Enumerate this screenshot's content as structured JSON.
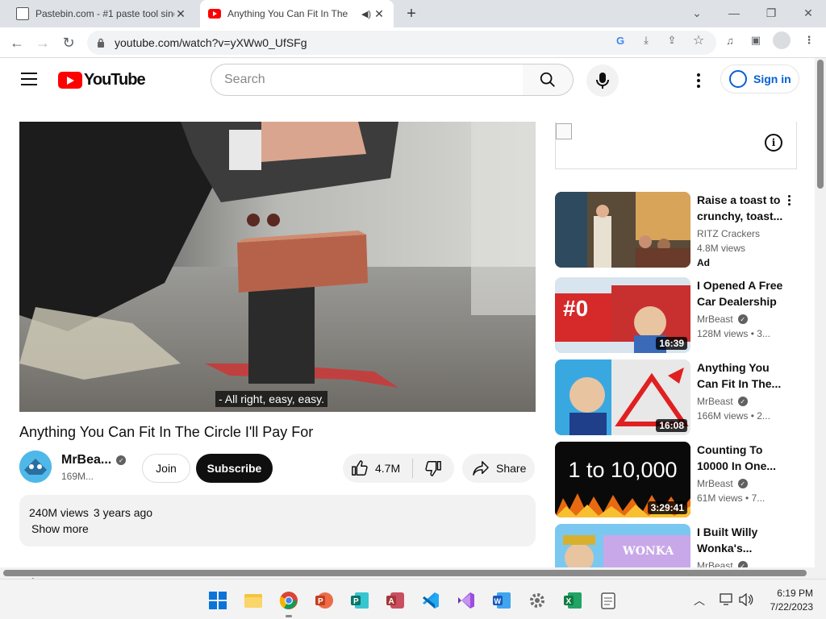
{
  "browser": {
    "tabs": [
      {
        "title": "Pastebin.com - #1 paste tool sinc",
        "active": false
      },
      {
        "title": "Anything You Can Fit In The",
        "active": true
      }
    ],
    "url": "youtube.com/watch?v=yXWw0_UfSFg"
  },
  "youtube": {
    "logo_text": "YouTube",
    "search_placeholder": "Search",
    "signin_label": "Sign in"
  },
  "video": {
    "caption": "- All right, easy, easy.",
    "title": "Anything You Can Fit In The Circle I'll Pay For",
    "channel": "MrBea...",
    "subscribers": "169M...",
    "join_label": "Join",
    "subscribe_label": "Subscribe",
    "likes": "4.7M",
    "share_label": "Share",
    "views": "240M views",
    "age": "3 years ago",
    "show_more": "Show more"
  },
  "recommendations": [
    {
      "title": "Raise a toast to crunchy, toast...",
      "channel": "RITZ Crackers",
      "views": "4.8M views",
      "badge": "Ad",
      "duration": "",
      "verified": false
    },
    {
      "title": "I Opened A Free Car Dealership",
      "channel": "MrBeast",
      "views": "128M views",
      "age": "3...",
      "duration": "16:39",
      "verified": true
    },
    {
      "title": "Anything You Can Fit In The...",
      "channel": "MrBeast",
      "views": "166M views",
      "age": "2...",
      "duration": "16:08",
      "verified": true
    },
    {
      "title": "Counting To 10000 In One...",
      "channel": "MrBeast",
      "views": "61M views",
      "age": "7...",
      "duration": "3:29:41",
      "verified": true,
      "thumb_text": "1 to 10,000"
    },
    {
      "title": "I Built Willy Wonka's...",
      "channel": "MrBeast",
      "views": "",
      "duration": "",
      "verified": true,
      "thumb_text": "WONKA"
    }
  ],
  "taskbar": {
    "time": "6:19 PM",
    "date": "7/22/2023"
  }
}
